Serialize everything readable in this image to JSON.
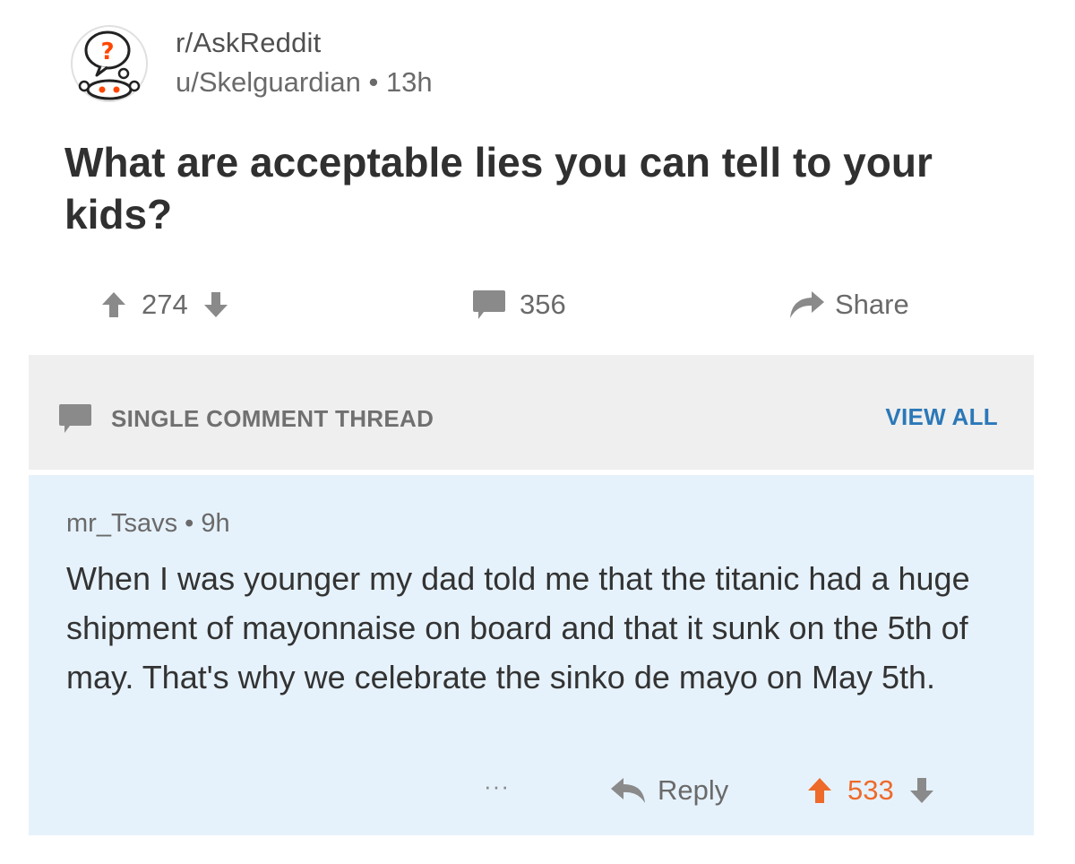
{
  "post": {
    "subreddit": "r/AskReddit",
    "author": "u/Skelguardian",
    "separator": "•",
    "age": "13h",
    "title": "What are acceptable lies you can tell to your kids?",
    "upvotes": "274",
    "comments": "356",
    "share_label": "Share"
  },
  "thread": {
    "label": "SINGLE COMMENT THREAD",
    "view_all": "VIEW ALL"
  },
  "comment": {
    "author": "mr_Tsavs",
    "separator": "•",
    "age": "9h",
    "body": "When I was younger my dad told me that the titanic had a huge shipment of mayonnaise on board and that it sunk on the 5th of may. That's why we celebrate the sinko de mayo on May 5th.",
    "more": "···",
    "reply_label": "Reply",
    "score": "533"
  },
  "colors": {
    "accent_link": "#2b78b8",
    "upvoted": "#ee6a2b",
    "thread_bg": "#efefef",
    "comment_bg": "#e6f2fb"
  },
  "icons": [
    "askreddit-avatar-icon",
    "upvote-arrow-icon",
    "downvote-arrow-icon",
    "comment-bubble-icon",
    "share-arrow-icon",
    "reply-arrow-icon"
  ]
}
